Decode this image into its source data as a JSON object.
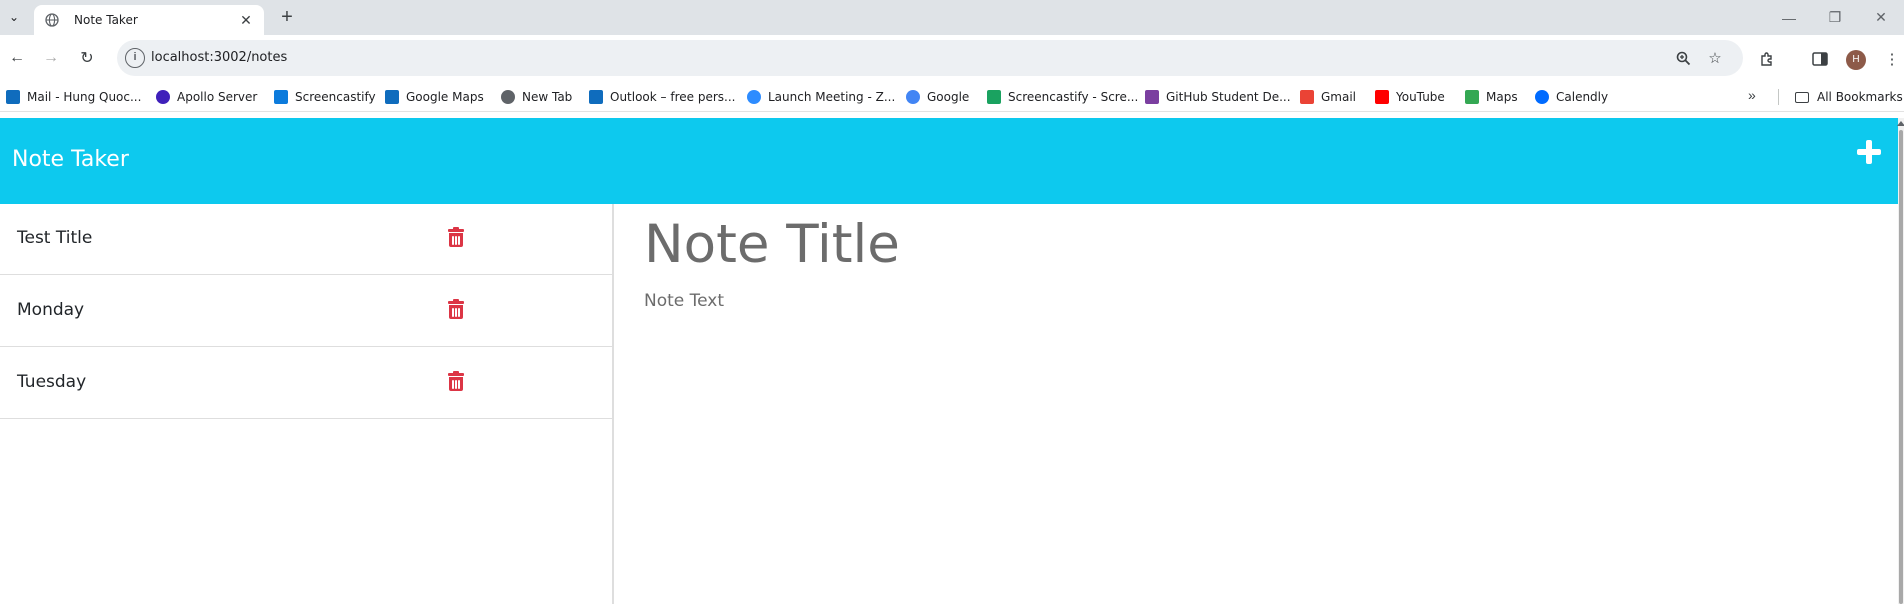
{
  "browser": {
    "tab_title": "Note Taker",
    "url": "localhost:3002/notes",
    "profile_initial": "H",
    "bookmarks": [
      {
        "label": "Mail - Hung Quoc...",
        "color": "#0f6cbd"
      },
      {
        "label": "Apollo Server",
        "color": "#3f20ba"
      },
      {
        "label": "Screencastify",
        "color": "#0c7bdc"
      },
      {
        "label": "Google Maps",
        "color": "#0f6cbd"
      },
      {
        "label": "New Tab",
        "color": "#5f6368"
      },
      {
        "label": "Outlook – free pers...",
        "color": "#0f6cbd"
      },
      {
        "label": "Launch Meeting - Z...",
        "color": "#2d8cff"
      },
      {
        "label": "Google",
        "color": "#4285f4"
      },
      {
        "label": "Screencastify - Scre...",
        "color": "#1aa260"
      },
      {
        "label": "GitHub Student De...",
        "color": "#7b3fa0"
      },
      {
        "label": "Gmail",
        "color": "#ea4335"
      },
      {
        "label": "YouTube",
        "color": "#ff0000"
      },
      {
        "label": "Maps",
        "color": "#34a853"
      },
      {
        "label": "Calendly",
        "color": "#006bff"
      }
    ],
    "all_bookmarks_label": "All Bookmarks"
  },
  "app": {
    "brand": "Note Taker",
    "accent_color": "#0dc9ee",
    "delete_color": "#dc3545",
    "notes": [
      {
        "title": "Test Title"
      },
      {
        "title": "Monday"
      },
      {
        "title": "Tuesday"
      }
    ],
    "editor": {
      "title_placeholder": "Note Title",
      "text_placeholder": "Note Text"
    }
  }
}
